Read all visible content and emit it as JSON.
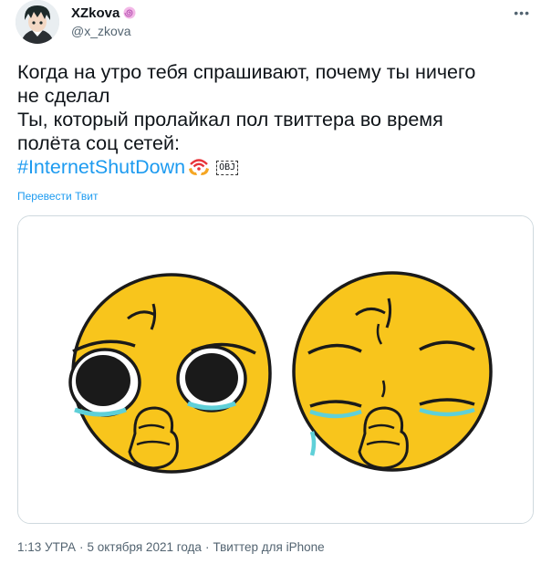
{
  "author": {
    "display_name": "XZkova",
    "handle": "@x_zkova",
    "avatar_icon": "anime-avatar",
    "badge_icon": "swirl-emoji-icon"
  },
  "more_label": "•••",
  "tweet": {
    "lines": [
      "Когда на утро тебя спрашивают, почему ты ничего",
      "не сделал",
      "Ты, который пролайкал пол твиттера во время",
      "полёта соц сетей:"
    ],
    "hashtag": "#InternetShutDown",
    "hashtag_emoji_icon": "wifi-hands-emoji-icon",
    "obj_label": "OBJ"
  },
  "translate_label": "Перевести Твит",
  "media": {
    "description_icon": "pleading-emoji-faces-image"
  },
  "meta": {
    "time": "1:13 УТРА",
    "date": "5 октября 2021 года",
    "source": "Твиттер для iPhone",
    "separator": "·"
  },
  "colors": {
    "link": "#1d9bf0",
    "secondary_text": "#536471",
    "emoji_yellow": "#f8c51c",
    "tear_blue": "#5fd0d8"
  }
}
